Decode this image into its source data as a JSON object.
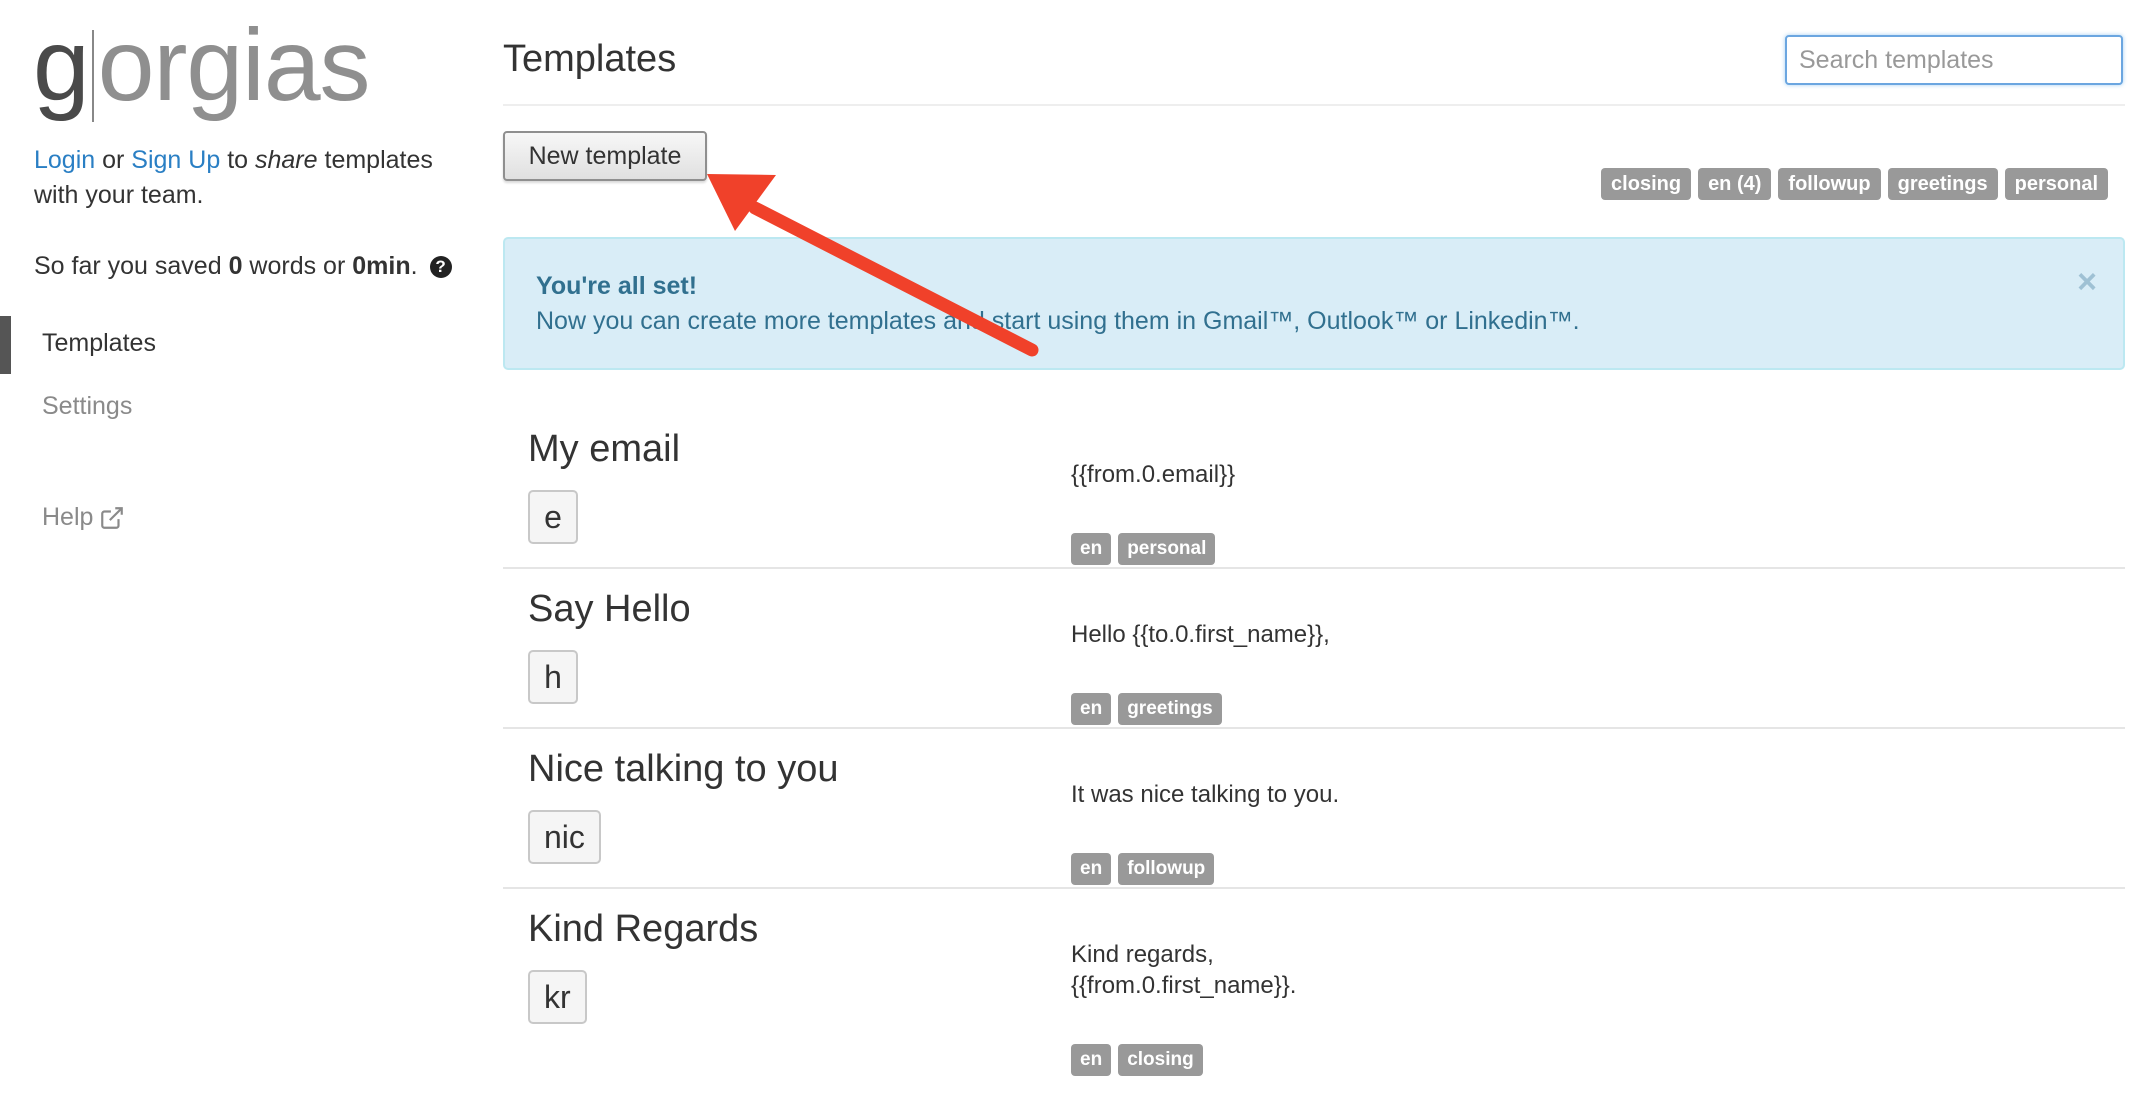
{
  "brand": {
    "logo_g": "g",
    "logo_rest": "orgias"
  },
  "sidebar": {
    "login_link": "Login",
    "or_text": " or ",
    "signup_link": "Sign Up",
    "to_text": " to ",
    "share_text": "share",
    "templates_text": " templates with your team.",
    "saved_prefix": "So far you saved ",
    "saved_words": "0",
    "saved_middle": " words or ",
    "saved_min": "0min",
    "saved_suffix": ".",
    "help_icon_glyph": "?",
    "nav": {
      "templates": "Templates",
      "settings": "Settings",
      "help": "Help"
    }
  },
  "header": {
    "title": "Templates",
    "search_placeholder": "Search templates"
  },
  "toolbar": {
    "new_template_label": "New template",
    "tag_filters": [
      "closing",
      "en (4)",
      "followup",
      "greetings",
      "personal"
    ]
  },
  "alert": {
    "title": "You're all set!",
    "message": "Now you can create more templates and start using them in Gmail™, Outlook™ or Linkedin™.",
    "close_glyph": "×"
  },
  "templates": [
    {
      "title": "My email",
      "shortcut": "e",
      "body": "{{from.0.email}}",
      "tags": [
        "en",
        "personal"
      ]
    },
    {
      "title": "Say Hello",
      "shortcut": "h",
      "body": "Hello {{to.0.first_name}},",
      "tags": [
        "en",
        "greetings"
      ]
    },
    {
      "title": "Nice talking to you",
      "shortcut": "nic",
      "body": "It was nice talking to you.",
      "tags": [
        "en",
        "followup"
      ]
    },
    {
      "title": "Kind Regards",
      "shortcut": "kr",
      "body": "Kind regards,\n{{from.0.first_name}}.",
      "tags": [
        "en",
        "closing"
      ]
    }
  ],
  "colors": {
    "link": "#2a7fc4",
    "tag": "#999999",
    "alert_bg": "#d9edf7",
    "alert_text": "#31708f",
    "arrow": "#f0412a"
  }
}
